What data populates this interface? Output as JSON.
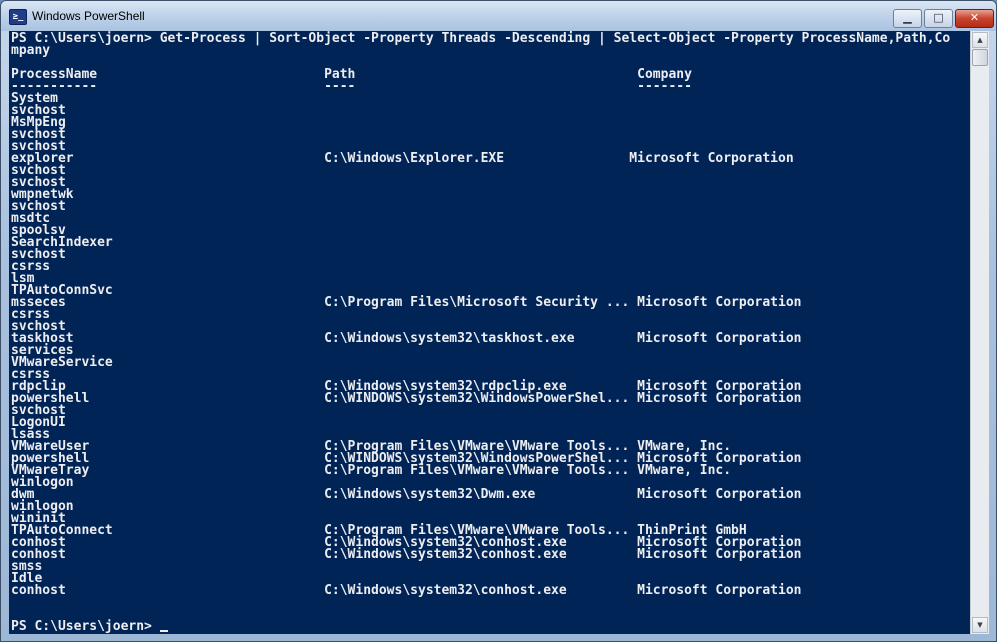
{
  "window": {
    "title": "Windows PowerShell",
    "icon_glyph": "≥_",
    "min_glyph": "▁",
    "max_glyph": "□",
    "close_glyph": "✕"
  },
  "colors": {
    "console_background": "#012456",
    "console_text": "#eeedf0"
  },
  "scrollbar": {
    "up_glyph": "▲",
    "down_glyph": "▼"
  },
  "terminal": {
    "lines": [
      "PS C:\\Users\\joern> Get-Process | Sort-Object -Property Threads -Descending | Select-Object -Property ProcessName,Path,Co",
      "mpany",
      "",
      "ProcessName                             Path                                    Company",
      "-----------                             ----                                    -------",
      "System",
      "svchost",
      "MsMpEng",
      "svchost",
      "svchost",
      "explorer                                C:\\Windows\\Explorer.EXE                Microsoft Corporation",
      "svchost",
      "svchost",
      "wmpnetwk",
      "svchost",
      "msdtc",
      "spoolsv",
      "SearchIndexer",
      "svchost",
      "csrss",
      "lsm",
      "TPAutoConnSvc",
      "msseces                                 C:\\Program Files\\Microsoft Security ... Microsoft Corporation",
      "csrss",
      "svchost",
      "taskhost                                C:\\Windows\\system32\\taskhost.exe        Microsoft Corporation",
      "services",
      "VMwareService",
      "csrss",
      "rdpclip                                 C:\\Windows\\system32\\rdpclip.exe         Microsoft Corporation",
      "powershell                              C:\\WINDOWS\\system32\\WindowsPowerShel... Microsoft Corporation",
      "svchost",
      "LogonUI",
      "lsass",
      "VMwareUser                              C:\\Program Files\\VMware\\VMware Tools... VMware, Inc.",
      "powershell                              C:\\WINDOWS\\system32\\WindowsPowerShel... Microsoft Corporation",
      "VMwareTray                              C:\\Program Files\\VMware\\VMware Tools... VMware, Inc.",
      "winlogon",
      "dwm                                     C:\\Windows\\system32\\Dwm.exe             Microsoft Corporation",
      "winlogon",
      "wininit",
      "TPAutoConnect                           C:\\Program Files\\VMware\\VMware Tools... ThinPrint GmbH",
      "conhost                                 C:\\Windows\\system32\\conhost.exe         Microsoft Corporation",
      "conhost                                 C:\\Windows\\system32\\conhost.exe         Microsoft Corporation",
      "smss",
      "Idle",
      "conhost                                 C:\\Windows\\system32\\conhost.exe         Microsoft Corporation",
      "",
      "",
      "PS C:\\Users\\joern> "
    ]
  }
}
